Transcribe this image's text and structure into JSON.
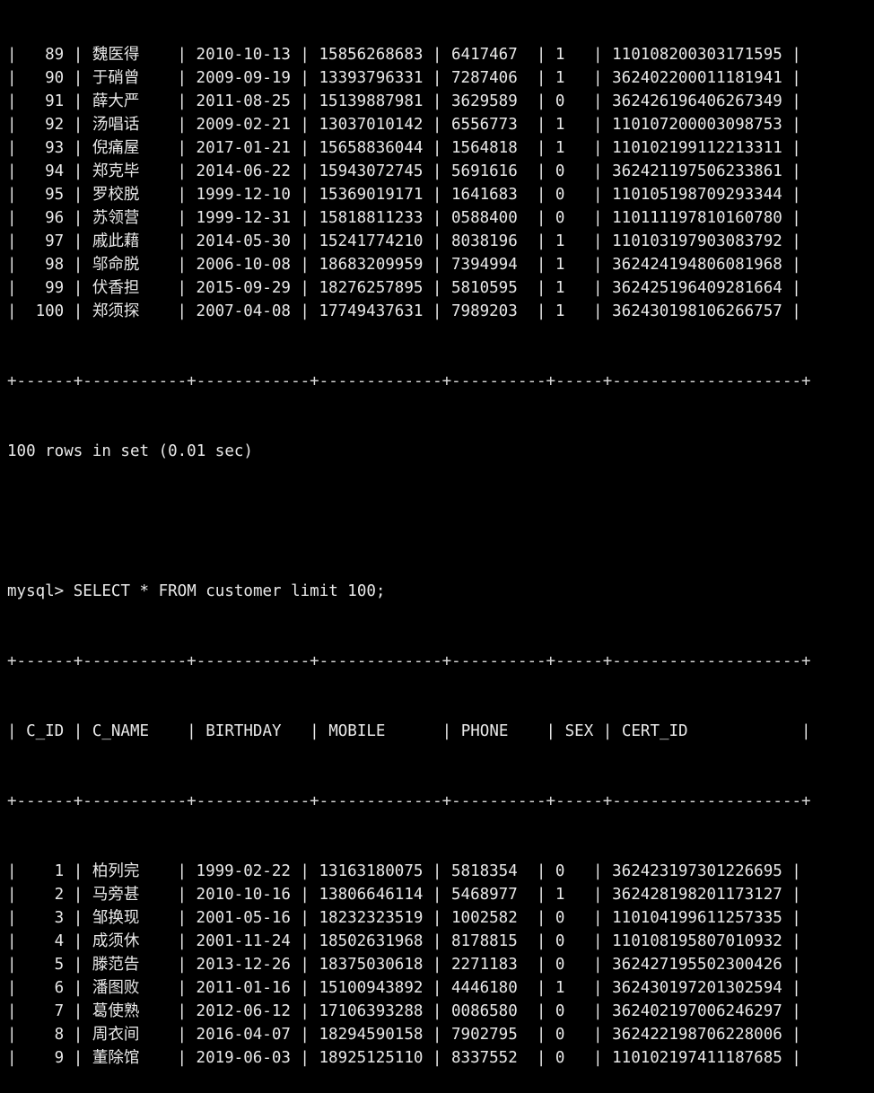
{
  "terminal": {
    "prompt": "mysql> ",
    "command": "SELECT * FROM customer limit 100;",
    "status_line": "100 rows in set (0.01 sec)",
    "rule_top": "+------+-----------+------------+-------------+----------+-----+--------------------+",
    "rule_mid": "+------+-----------+------------+-------------+----------+-----+--------------------+",
    "rule_bottom": "+------+-----------+------------+-------------+----------+-----+--------------------+"
  },
  "table": {
    "columns": [
      "C_ID",
      "C_NAME",
      "BIRTHDAY",
      "MOBILE",
      "PHONE",
      "SEX",
      "CERT_ID"
    ],
    "header_line": "| C_ID | C_NAME    | BIRTHDAY   | MOBILE      | PHONE    | SEX | CERT_ID            |"
  },
  "top_result_rows": [
    {
      "c_id": "89",
      "c_name": "魏医得",
      "birthday": "2010-10-13",
      "mobile": "15856268683",
      "phone": "6417467",
      "sex": "1",
      "cert_id": "110108200303171595"
    },
    {
      "c_id": "90",
      "c_name": "于硝曾",
      "birthday": "2009-09-19",
      "mobile": "13393796331",
      "phone": "7287406",
      "sex": "1",
      "cert_id": "362402200011181941"
    },
    {
      "c_id": "91",
      "c_name": "薛大严",
      "birthday": "2011-08-25",
      "mobile": "15139887981",
      "phone": "3629589",
      "sex": "0",
      "cert_id": "362426196406267349"
    },
    {
      "c_id": "92",
      "c_name": "汤唱话",
      "birthday": "2009-02-21",
      "mobile": "13037010142",
      "phone": "6556773",
      "sex": "1",
      "cert_id": "110107200003098753"
    },
    {
      "c_id": "93",
      "c_name": "倪痛屋",
      "birthday": "2017-01-21",
      "mobile": "15658836044",
      "phone": "1564818",
      "sex": "1",
      "cert_id": "110102199112213311"
    },
    {
      "c_id": "94",
      "c_name": "郑克毕",
      "birthday": "2014-06-22",
      "mobile": "15943072745",
      "phone": "5691616",
      "sex": "0",
      "cert_id": "362421197506233861"
    },
    {
      "c_id": "95",
      "c_name": "罗校脱",
      "birthday": "1999-12-10",
      "mobile": "15369019171",
      "phone": "1641683",
      "sex": "0",
      "cert_id": "110105198709293344"
    },
    {
      "c_id": "96",
      "c_name": "苏领营",
      "birthday": "1999-12-31",
      "mobile": "15818811233",
      "phone": "0588400",
      "sex": "0",
      "cert_id": "110111197810160780"
    },
    {
      "c_id": "97",
      "c_name": "戚此藉",
      "birthday": "2014-05-30",
      "mobile": "15241774210",
      "phone": "8038196",
      "sex": "1",
      "cert_id": "110103197903083792"
    },
    {
      "c_id": "98",
      "c_name": "邬命脱",
      "birthday": "2006-10-08",
      "mobile": "18683209959",
      "phone": "7394994",
      "sex": "1",
      "cert_id": "362424194806081968"
    },
    {
      "c_id": "99",
      "c_name": "伏香担",
      "birthday": "2015-09-29",
      "mobile": "18276257895",
      "phone": "5810595",
      "sex": "1",
      "cert_id": "362425196409281664"
    },
    {
      "c_id": "100",
      "c_name": "郑须探",
      "birthday": "2007-04-08",
      "mobile": "17749437631",
      "phone": "7989203",
      "sex": "1",
      "cert_id": "362430198106266757"
    }
  ],
  "bottom_result_rows": [
    {
      "c_id": "1",
      "c_name": "柏列完",
      "birthday": "1999-02-22",
      "mobile": "13163180075",
      "phone": "5818354",
      "sex": "0",
      "cert_id": "362423197301226695"
    },
    {
      "c_id": "2",
      "c_name": "马旁甚",
      "birthday": "2010-10-16",
      "mobile": "13806646114",
      "phone": "5468977",
      "sex": "1",
      "cert_id": "362428198201173127"
    },
    {
      "c_id": "3",
      "c_name": "邹换现",
      "birthday": "2001-05-16",
      "mobile": "18232323519",
      "phone": "1002582",
      "sex": "0",
      "cert_id": "110104199611257335"
    },
    {
      "c_id": "4",
      "c_name": "成须休",
      "birthday": "2001-11-24",
      "mobile": "18502631968",
      "phone": "8178815",
      "sex": "0",
      "cert_id": "110108195807010932"
    },
    {
      "c_id": "5",
      "c_name": "滕范告",
      "birthday": "2013-12-26",
      "mobile": "18375030618",
      "phone": "2271183",
      "sex": "0",
      "cert_id": "362427195502300426"
    },
    {
      "c_id": "6",
      "c_name": "潘图败",
      "birthday": "2011-01-16",
      "mobile": "15100943892",
      "phone": "4446180",
      "sex": "1",
      "cert_id": "362430197201302594"
    },
    {
      "c_id": "7",
      "c_name": "葛使熟",
      "birthday": "2012-06-12",
      "mobile": "17106393288",
      "phone": "0086580",
      "sex": "0",
      "cert_id": "362402197006246297"
    },
    {
      "c_id": "8",
      "c_name": "周衣间",
      "birthday": "2016-04-07",
      "mobile": "18294590158",
      "phone": "7902795",
      "sex": "0",
      "cert_id": "362422198706228006"
    },
    {
      "c_id": "9",
      "c_name": "董除馆",
      "birthday": "2019-06-03",
      "mobile": "18925125110",
      "phone": "8337552",
      "sex": "0",
      "cert_id": "110102197411187685"
    }
  ],
  "colors": {
    "background": "#000000",
    "foreground": "#e9e9e9"
  }
}
